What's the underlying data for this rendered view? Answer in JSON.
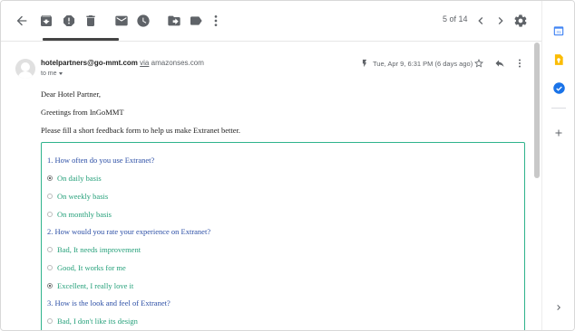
{
  "toolbar": {
    "pager_text": "5 of 14",
    "icons": [
      "back-arrow-icon",
      "archive-icon",
      "report-spam-icon",
      "delete-icon",
      "mark-unread-icon",
      "snooze-icon",
      "move-to-icon",
      "label-icon",
      "more-vert-icon",
      "prev-icon",
      "next-icon",
      "settings-icon"
    ]
  },
  "email": {
    "sender_email": "hotelpartners@go-mmt.com",
    "via": "via",
    "via_domain": "amazonses.com",
    "to": "to me",
    "date": "Tue, Apr 9, 6:31 PM (6 days ago)",
    "greeting": "Dear Hotel Partner,",
    "line1": "Greetings from InGoMMT",
    "line2": "Please fill a short feedback form to help us make Extranet better."
  },
  "form": {
    "questions": [
      {
        "label": "1. How often do you use Extranet?",
        "options": [
          {
            "label": "On daily basis",
            "selected": true
          },
          {
            "label": "On weekly basis",
            "selected": false
          },
          {
            "label": "On monthly basis",
            "selected": false
          }
        ]
      },
      {
        "label": "2. How would you rate your experience on Extranet?",
        "options": [
          {
            "label": "Bad, It needs improvement",
            "selected": false
          },
          {
            "label": "Good, It works for me",
            "selected": false
          },
          {
            "label": "Excellent, I really love it",
            "selected": true
          }
        ]
      },
      {
        "label": "3. How is the look and feel of Extranet?",
        "options": [
          {
            "label": "Bad, I don't like its design",
            "selected": false
          }
        ]
      }
    ]
  },
  "colors": {
    "question": "#2c4fa6",
    "option": "#25a07a",
    "form_border": "#2fb38c",
    "google_blue": "#4285f4",
    "keep_yellow": "#fbbc04"
  }
}
